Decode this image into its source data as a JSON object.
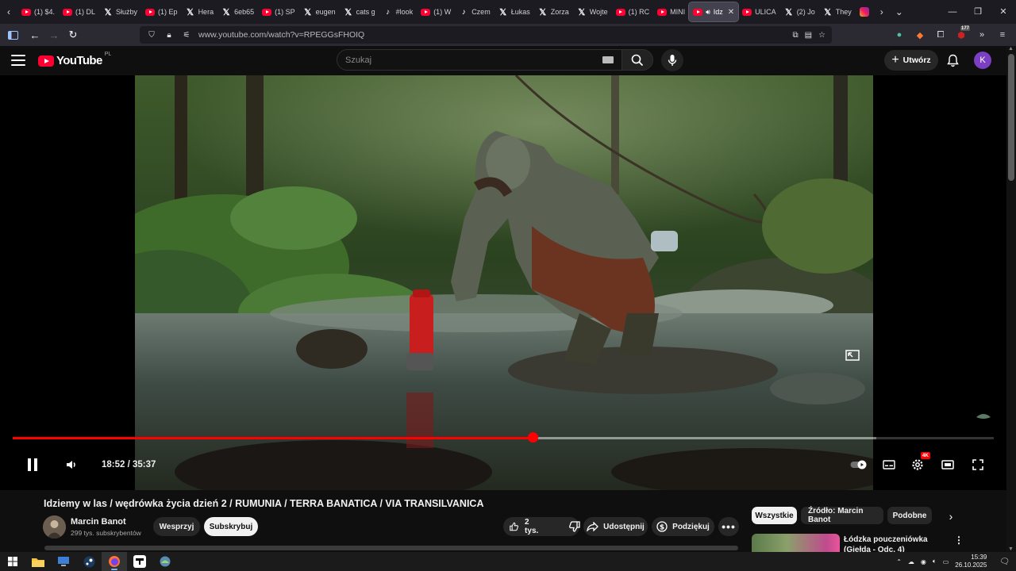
{
  "browser": {
    "tabs": [
      {
        "label": "(1) $4.",
        "icon": "youtube-icon",
        "type": "yt"
      },
      {
        "label": "(1) DL",
        "icon": "youtube-icon",
        "type": "yt"
      },
      {
        "label": "Służby",
        "icon": "x-icon",
        "type": "x"
      },
      {
        "label": "(1) Ep",
        "icon": "youtube-icon",
        "type": "yt"
      },
      {
        "label": "Hera",
        "icon": "x-icon",
        "type": "x"
      },
      {
        "label": "6eb65",
        "icon": "x-icon",
        "type": "x"
      },
      {
        "label": "(1) SP",
        "icon": "youtube-icon",
        "type": "yt"
      },
      {
        "label": "eugen",
        "icon": "x-icon",
        "type": "x"
      },
      {
        "label": "cats g",
        "icon": "x-icon",
        "type": "x"
      },
      {
        "label": "#look",
        "icon": "tiktok-icon",
        "type": "tt"
      },
      {
        "label": "(1) W",
        "icon": "youtube-icon",
        "type": "yt"
      },
      {
        "label": "Czem",
        "icon": "tiktok-icon",
        "type": "tt"
      },
      {
        "label": "Łukas",
        "icon": "x-icon",
        "type": "x"
      },
      {
        "label": "Zorza",
        "icon": "x-icon",
        "type": "x"
      },
      {
        "label": "Wojte",
        "icon": "x-icon",
        "type": "x"
      },
      {
        "label": "(1) RC",
        "icon": "youtube-icon",
        "type": "yt"
      },
      {
        "label": "MINI",
        "icon": "youtube-icon",
        "type": "yt"
      },
      {
        "label": "Idz",
        "icon": "youtube-icon",
        "type": "yt",
        "active": true
      },
      {
        "label": "ULICA",
        "icon": "youtube-icon",
        "type": "yt"
      },
      {
        "label": "(2) Jo",
        "icon": "x-icon",
        "type": "x"
      },
      {
        "label": "They",
        "icon": "x-icon",
        "type": "x"
      },
      {
        "label": "",
        "icon": "instagram-icon",
        "type": "ig"
      }
    ],
    "url": "www.youtube.com/watch?v=RPEGGsFHOIQ",
    "extension_badge": "177"
  },
  "youtube": {
    "logo_text": "YouTube",
    "country_code": "PL",
    "search_placeholder": "Szukaj",
    "create_label": "Utwórz",
    "avatar_letter": "K"
  },
  "player": {
    "current_time": "18:52",
    "duration": "35:37",
    "time_display": "18:52 / 35:37",
    "progress_fraction": 0.53,
    "buffered_fraction": 0.88,
    "quality_badge": "4K"
  },
  "video": {
    "title": "Idziemy w las / wędrówka życia dzień 2 / RUMUNIA / TERRA BANATICA / VIA TRANSILVANICA",
    "channel": "Marcin Banot",
    "subscribers": "299 tys. subskrybentów",
    "support_label": "Wesprzyj",
    "subscribe_label": "Subskrybuj",
    "likes": "2 tys.",
    "share_label": "Udostępnij",
    "thanks_label": "Podziękuj"
  },
  "sidebar": {
    "chips": [
      "Wszystkie",
      "Źródło: Marcin Banot",
      "Podobne"
    ],
    "recommended_title": "Łódzka pouczeniówka (Giełda - Odc. 4)"
  },
  "taskbar": {
    "time": "15:39",
    "date": "26.10.2025"
  },
  "colors": {
    "accent_red": "#ff0000",
    "avatar_purple": "#7b3fc4"
  }
}
